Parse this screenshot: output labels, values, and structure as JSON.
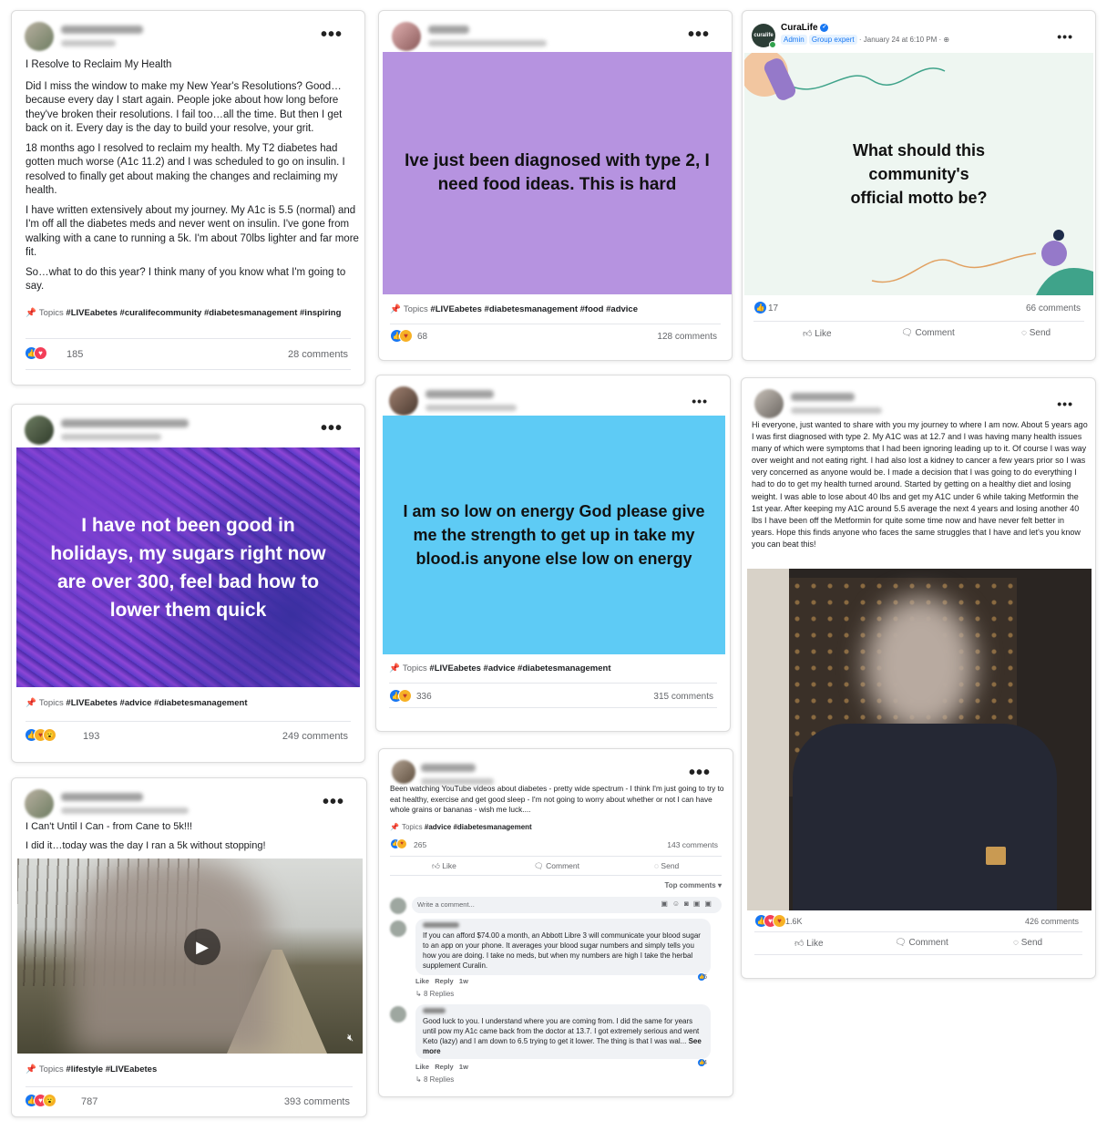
{
  "post1": {
    "title": "I Resolve to Reclaim My Health",
    "paragraphs": [
      "Did I miss the window to make my New Year's Resolutions?  Good… because every day I start again.  People joke about how long before they've broken their resolutions.  I fail too…all the time.  But then I get back on it.  Every day is the day to build your resolve, your grit.",
      "18 months ago I resolved to reclaim my health.  My T2 diabetes had gotten much worse (A1c 11.2) and I was scheduled to go on insulin.  I resolved to finally get about making the changes and reclaiming my health.",
      "I have written extensively about my journey.  My A1c is 5.5 (normal) and I'm off all the diabetes meds and never went on insulin.  I've gone from walking with a cane to running a 5k.  I'm about 70lbs lighter and far more fit.",
      "So…what to do this year?  I think many of you know what I'm going to say."
    ],
    "topics_label": "Topics",
    "topics": "#LIVEabetes #curalifecommunity #diabetesmanagement #inspiring",
    "reactions": "185",
    "comments": "28 comments"
  },
  "post2": {
    "banner_text": "Ive just been diagnosed with type 2, I need food ideas. This is hard",
    "banner_color": "#b693e0",
    "topics_label": "Topics",
    "topics": "#LIVEabetes #diabetesmanagement #food #advice",
    "reactions": "68",
    "comments": "128 comments"
  },
  "post3": {
    "author": "CuraLife",
    "avatar_text": "curalife",
    "badge_admin": "Admin",
    "badge_expert": "Group expert",
    "timestamp": "January 24 at 6:10 PM",
    "banner_text": "What should this community's official motto be?",
    "reactions": "17",
    "comments": "66 comments",
    "actions": [
      "Like",
      "Comment",
      "Send"
    ]
  },
  "post4": {
    "banner_text": "I have not been good in holidays, my sugars right now are over 300, feel bad how to lower them quick",
    "topics_label": "Topics",
    "topics": "#LIVEabetes #advice #diabetesmanagement",
    "reactions": "193",
    "comments": "249 comments"
  },
  "post5": {
    "banner_text": "I am so low on energy God please give me the strength to get up in take my blood.is anyone else low on energy",
    "banner_color": "#5ecbf5",
    "topics_label": "Topics",
    "topics": "#LIVEabetes #advice #diabetesmanagement",
    "reactions": "336",
    "comments": "315 comments"
  },
  "post6": {
    "text": "Hi everyone, just wanted to share with you my journey to where I am now. About 5 years ago I was first diagnosed with type 2.  My A1C was at 12.7 and I was having many health issues many of which were symptoms that I had been ignoring leading up to it. Of course I was way over weight and not eating right. I had also lost a kidney to cancer a few years prior so I was very concerned as anyone would be. I made a decision that I was going to do everything I had to do to get my health turned around. Started by getting on a healthy diet and losing weight. I was able to lose about 40 lbs and get my A1C under 6 while taking Metformin the 1st year. After keeping my A1C around 5.5 average the next 4 years and losing another 40 lbs I have been off the Metformin for quite some time now and have never felt better in years. Hope this finds anyone who faces the same struggles that I have and let's you know you can beat this!",
    "reactions": "1.6K",
    "comments": "426 comments",
    "actions": [
      "Like",
      "Comment",
      "Send"
    ]
  },
  "post7": {
    "title": "I Can't Until I Can - from Cane to 5k!!!",
    "body": "I did it…today was the day I ran a 5k without stopping!",
    "topics_label": "Topics",
    "topics": "#lifestyle #LIVEabetes",
    "reactions": "787",
    "comments": "393 comments"
  },
  "post8": {
    "text": "Been watching YouTube videos about diabetes - pretty wide spectrum - I think I'm just going to try to eat healthy, exercise and get good sleep - I'm not going to worry about whether or not I can have whole grains or bananas - wish me luck....",
    "topics_label": "Topics",
    "topics": "#advice #diabetesmanagement",
    "reactions": "265",
    "comments": "143 comments",
    "actions": [
      "Like",
      "Comment",
      "Send"
    ],
    "sort_label": "Top comments",
    "write_placeholder": "Write a comment...",
    "comment1": "If you can afford $74.00 a month, an Abbott Libre 3 will communicate your blood sugar to an app on your phone. It averages your blood sugar numbers and simply tells you how you are doing. I take no meds, but when my numbers are high I take the herbal supplement Curalin.",
    "comment1_reacts": "5",
    "comment1_meta": "Like   Reply   1w",
    "comment1_replies": "8 Replies",
    "comment2": "Good luck to you. I understand where you are coming from. I did the same for years until pow my A1c came back from the doctor at 13.7. I got extremely serious and went Keto (lazy) and I am down to 6.5 trying to get it lower. The thing is that I was wal...",
    "comment2_more": "See more",
    "comment2_reacts": "4",
    "comment2_meta": "Like   Reply   1w",
    "comment2_replies": "8 Replies"
  }
}
